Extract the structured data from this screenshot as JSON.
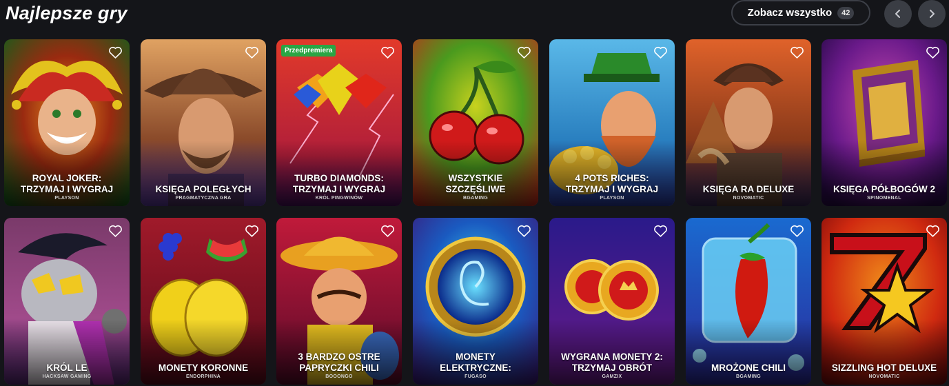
{
  "section": {
    "title": "Najlepsze gry",
    "see_all_label": "Zobacz wszystko",
    "see_all_count": "42",
    "prev_icon": "chevron-left-icon",
    "next_icon": "chevron-right-icon"
  },
  "games": [
    {
      "name": "Royal Joker:\nTrzymaj i wygraj",
      "provider": "Playson",
      "badge": ""
    },
    {
      "name": "Księga Poległych",
      "provider": "Pragmatyczna gra",
      "badge": ""
    },
    {
      "name": "Turbo Diamonds:\nTrzymaj i wygraj",
      "provider": "Król Pingwinów",
      "badge": "Przedpremiera"
    },
    {
      "name": "Wszystkie\nszczęśliwe",
      "provider": "BGaming",
      "badge": ""
    },
    {
      "name": "4 Pots Riches:\nTrzymaj i wygraj",
      "provider": "Playson",
      "badge": ""
    },
    {
      "name": "Księga Ra Deluxe",
      "provider": "Novomatic",
      "badge": ""
    },
    {
      "name": "Księga Półbogów 2",
      "provider": "Spinomenal",
      "badge": ""
    },
    {
      "name": "Król Le",
      "provider": "Hacksaw Gaming",
      "badge": ""
    },
    {
      "name": "Monety Koronne",
      "provider": "Endorphina",
      "badge": ""
    },
    {
      "name": "3 Bardzo Ostre\nPapryczki Chili",
      "provider": "Booongo",
      "badge": ""
    },
    {
      "name": "Monety\nElektryczne:",
      "provider": "Fugaso",
      "badge": ""
    },
    {
      "name": "Wygrana Monety 2:\nTrzymaj obrót",
      "provider": "Gamzix",
      "badge": ""
    },
    {
      "name": "Mrożone Chili",
      "provider": "BGaming",
      "badge": ""
    },
    {
      "name": "Sizzling Hot Deluxe",
      "provider": "Novomatic",
      "badge": ""
    }
  ],
  "colors": {
    "background": "#141519",
    "badge": "#2aa544",
    "button_border": "#3c3f47"
  }
}
